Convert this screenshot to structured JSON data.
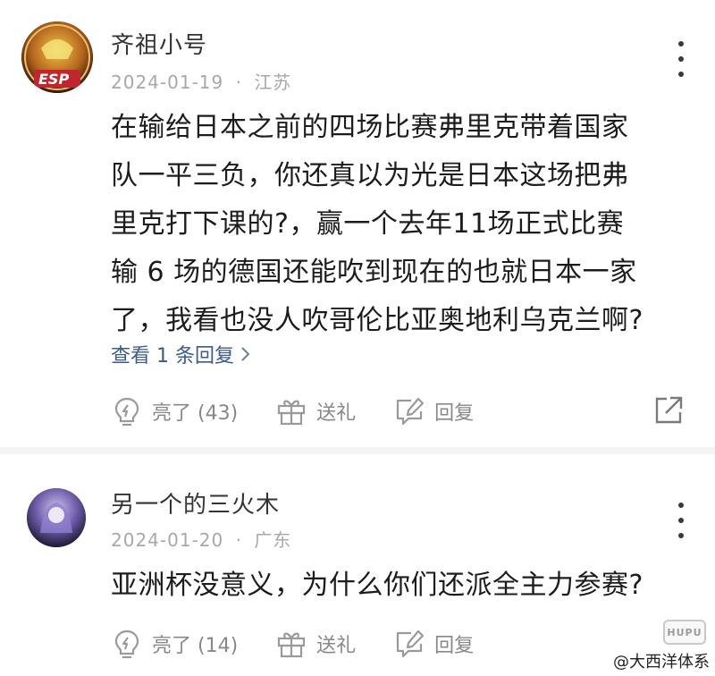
{
  "comments": [
    {
      "username": "齐祖小号",
      "date": "2024-01-19",
      "location": "江苏",
      "avatar_badge": "ESP",
      "content_lines": [
        "在输给日本之前的四场比赛弗里克带着国家",
        "队一平三负，你还真以为光是日本这场把弗",
        "里克打下课的?，赢一个去年11场正式比赛",
        "输 6 场的德国还能吹到现在的也就日本一家",
        "了，我看也没人吹哥伦比亚奥地利乌克兰啊?"
      ],
      "view_replies": "查看 1 条回复",
      "like_label": "亮了 (43)",
      "gift_label": "送礼",
      "reply_label": "回复"
    },
    {
      "username": "另一个的三火木",
      "date": "2024-01-20",
      "location": "广东",
      "content_lines": [
        "亚洲杯没意义，为什么你们还派全主力参赛?"
      ],
      "like_label": "亮了 (14)",
      "gift_label": "送礼",
      "reply_label": "回复"
    }
  ],
  "meta_separator": "·",
  "watermark": {
    "text": "@大西洋体系",
    "logo_text": "HUPU"
  },
  "icons": {
    "like": "lightbulb-icon",
    "gift": "gift-icon",
    "reply": "reply-edit-icon",
    "share": "share-icon",
    "more": "more-vertical-icon"
  }
}
